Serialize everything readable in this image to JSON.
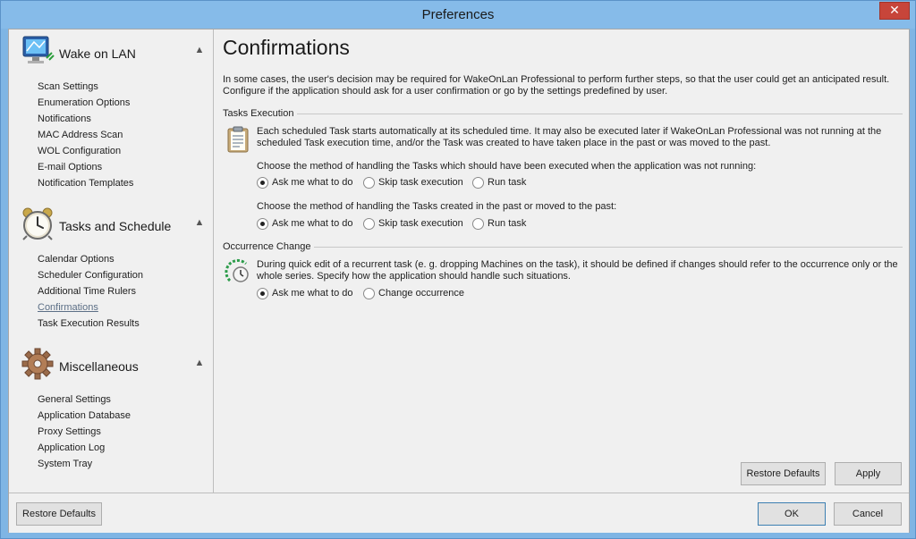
{
  "window": {
    "title": "Preferences",
    "close_glyph": "✕"
  },
  "sidebar": {
    "groups": [
      {
        "title": "Wake on LAN",
        "icon": "monitor-network-icon",
        "items": [
          "Scan Settings",
          "Enumeration Options",
          "Notifications",
          "MAC Address Scan",
          "WOL Configuration",
          "E-mail Options",
          "Notification Templates"
        ]
      },
      {
        "title": "Tasks and Schedule",
        "icon": "alarm-clock-icon",
        "items": [
          "Calendar Options",
          "Scheduler Configuration",
          "Additional Time Rulers",
          "Confirmations",
          "Task Execution Results"
        ]
      },
      {
        "title": "Miscellaneous",
        "icon": "gear-icon",
        "items": [
          "General Settings",
          "Application Database",
          "Proxy Settings",
          "Application Log",
          "System Tray"
        ]
      }
    ],
    "active_item": "Confirmations"
  },
  "main": {
    "title": "Confirmations",
    "intro": "In some cases, the user's decision may be required for WakeOnLan Professional to perform further steps, so that the user could get an anticipated result. Configure if the application should ask for a user confirmation or go by the settings predefined by user.",
    "tasks_execution": {
      "label": "Tasks Execution",
      "description": "Each scheduled Task starts automatically at its scheduled time. It may also be executed later if WakeOnLan Professional was not running at the scheduled Task execution time, and/or the Task was created to have taken place in the past or was moved to the past.",
      "question1": "Choose the method of handling the Tasks which should have been executed when the application was not running:",
      "question2": "Choose the method of handling the Tasks created in the past or moved to the past:",
      "options": [
        "Ask me what to do",
        "Skip task execution",
        "Run task"
      ],
      "selected1": "Ask me what to do",
      "selected2": "Ask me what to do"
    },
    "occurrence_change": {
      "label": "Occurrence Change",
      "description": "During quick edit of a recurrent task (e. g. dropping Machines on the task), it should be defined if changes should refer to the occurrence only or the whole series. Specify how the application should handle such situations.",
      "options": [
        "Ask me what to do",
        "Change occurrence"
      ],
      "selected": "Ask me what to do"
    },
    "restore_defaults_label": "Restore Defaults",
    "apply_label": "Apply"
  },
  "footer": {
    "restore_defaults_label": "Restore Defaults",
    "ok_label": "OK",
    "cancel_label": "Cancel"
  },
  "colors": {
    "titlebar": "#86bbe9",
    "close_button": "#c7453a",
    "active_link": "#5c6f86"
  }
}
